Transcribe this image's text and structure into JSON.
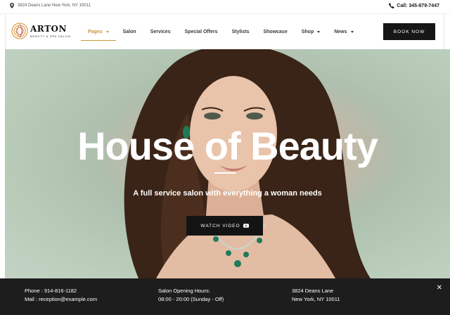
{
  "topbar": {
    "address": "3824 Deans Lane New York, NY 10011",
    "call": "Call: 345-879-7447"
  },
  "brand": {
    "name": "ARTON",
    "tagline": "BEAUTY & SPA SALON",
    "accent": "#c49a3e"
  },
  "nav": {
    "items": [
      {
        "label": "Pages",
        "dropdown": true,
        "active": true
      },
      {
        "label": "Salon",
        "dropdown": false
      },
      {
        "label": "Services",
        "dropdown": false
      },
      {
        "label": "Special Offers",
        "dropdown": false
      },
      {
        "label": "Stylists",
        "dropdown": false
      },
      {
        "label": "Showcase",
        "dropdown": false
      },
      {
        "label": "Shop",
        "dropdown": true
      },
      {
        "label": "News",
        "dropdown": true
      }
    ],
    "book_now": "BOOK NOW"
  },
  "hero": {
    "title": "House of Beauty",
    "subtitle": "A full service salon with everything a woman needs",
    "watch_label": "WATCH VIDEO"
  },
  "infobar": {
    "phone": "Phone : 914-816-1182",
    "mail": "Mail : reception@example.com",
    "hours_title": "Salon Opening Hours:",
    "hours": "08:00 - 20:00 (Sunday - Off)",
    "address_line1": "3824 Deans Lane",
    "address_line2": "New York, NY 10011",
    "close": "✕"
  }
}
